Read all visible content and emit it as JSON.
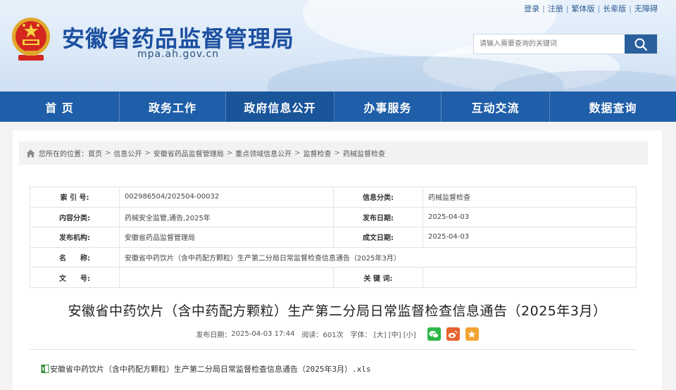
{
  "top_links": [
    "登录",
    "注册",
    "繁体版",
    "长辈版",
    "无障碍"
  ],
  "site": {
    "title": "安徽省药品监督管理局",
    "domain": "mpa.ah.gov.cn"
  },
  "search": {
    "placeholder": "请输入需要查询的关键词"
  },
  "nav": [
    "首 页",
    "政务工作",
    "政府信息公开",
    "办事服务",
    "互动交流",
    "数据查询"
  ],
  "breadcrumb": {
    "prefix": "您所在的位置：",
    "items": [
      "首页",
      "信息公开",
      "安徽省药品监督管理局",
      "重点领域信息公开",
      "监督检查",
      "药械监督检查"
    ]
  },
  "meta": {
    "index_label": "索 引 号:",
    "index_value": "002986504/202504-00032",
    "info_class_label": "信息分类:",
    "info_class_value": "药械监督检查",
    "content_class_label": "内容分类:",
    "content_class_value": "药械安全监管,通告,2025年",
    "publish_date_label": "发布日期:",
    "publish_date_value": "2025-04-03",
    "publisher_label": "发布机构:",
    "publisher_value": "安徽省药品监督管理局",
    "created_date_label": "成文日期:",
    "created_date_value": "2025-04-03",
    "name_label": "名　　称:",
    "name_value": "安徽省中药饮片（含中药配方颗粒）生产第二分局日常监督检查信息通告（2025年3月）",
    "doc_no_label": "文　　号:",
    "doc_no_value": "",
    "keywords_label": "关 键 词:",
    "keywords_value": ""
  },
  "article": {
    "title": "安徽省中药饮片（含中药配方颗粒）生产第二分局日常监督检查信息通告（2025年3月）",
    "publish_label": "发布日期：",
    "publish_time": "2025-04-03 17:44",
    "views_label": "阅读：",
    "views": "601次",
    "font_label": "字体：",
    "font_large": "[大]",
    "font_medium": "[中]",
    "font_small": "[小]",
    "attachment": "安徽省中药饮片（含中药配方颗粒）生产第二分局日常监督检查信息通告（2025年3月）.xls"
  },
  "colors": {
    "brand_blue": "#1f5ea8",
    "title_blue": "#1c4fa0",
    "wechat": "#2eb84a",
    "weibo": "#e6622e",
    "favorite": "#f2a432"
  }
}
